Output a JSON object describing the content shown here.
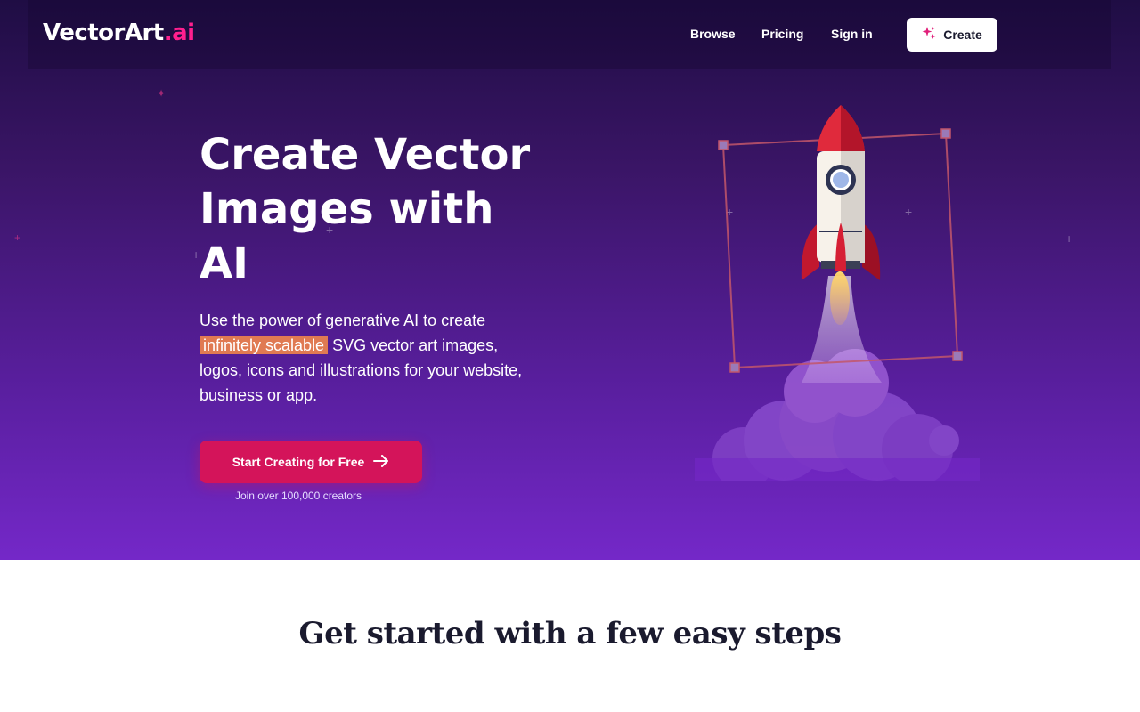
{
  "logo": {
    "main": "VectorArt",
    "accent": ".ai"
  },
  "nav": {
    "browse": "Browse",
    "pricing": "Pricing",
    "signin": "Sign in",
    "create": "Create"
  },
  "hero": {
    "title": "Create Vector Images with AI",
    "desc_before": "Use the power of generative AI to create ",
    "desc_highlight": "infinitely scalable",
    "desc_after": " SVG vector art images, logos, icons and illustrations for your website, business or app.",
    "cta": "Start Creating for Free",
    "cta_sub": "Join over 100,000 creators"
  },
  "steps": {
    "title": "Get started with a few easy steps"
  },
  "colors": {
    "brand_accent": "#ff1f8e",
    "cta": "#d4145a",
    "highlight": "#e07a52",
    "hero_top": "#1f0d44",
    "hero_bottom": "#7428c8"
  },
  "icons": {
    "create_icon": "sparkle-icon",
    "cta_icon": "arrow-right-icon",
    "illustration": "rocket-illustration"
  }
}
